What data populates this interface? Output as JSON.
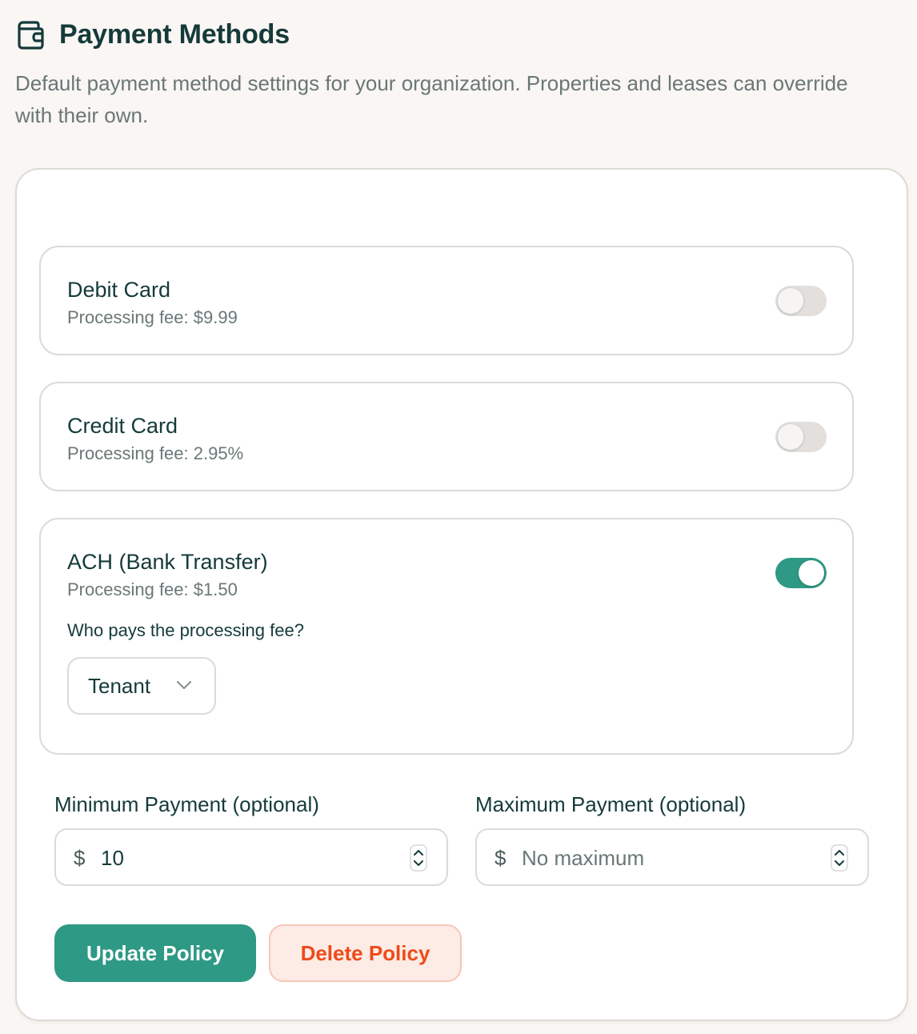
{
  "header": {
    "title": "Payment Methods",
    "icon": "wallet-icon",
    "subtitle": "Default payment method settings for your organization. Properties and leases can override with their own."
  },
  "methods": [
    {
      "name": "Debit Card",
      "fee": "Processing fee: $9.99",
      "enabled": false
    },
    {
      "name": "Credit Card",
      "fee": "Processing fee: 2.95%",
      "enabled": false
    },
    {
      "name": "ACH (Bank Transfer)",
      "fee": "Processing fee: $1.50",
      "enabled": true,
      "fee_payer_question": "Who pays the processing fee?",
      "fee_payer": "Tenant"
    }
  ],
  "limits": {
    "min_label": "Minimum Payment (optional)",
    "min_currency": "$",
    "min_value": "10",
    "max_label": "Maximum Payment (optional)",
    "max_currency": "$",
    "max_placeholder": "No maximum"
  },
  "actions": {
    "update_label": "Update Policy",
    "delete_label": "Delete Policy"
  },
  "colors": {
    "accent": "#2e9984",
    "danger": "#ef4a1a",
    "danger_bg": "#fdebe5",
    "background": "#f9f6f3"
  }
}
